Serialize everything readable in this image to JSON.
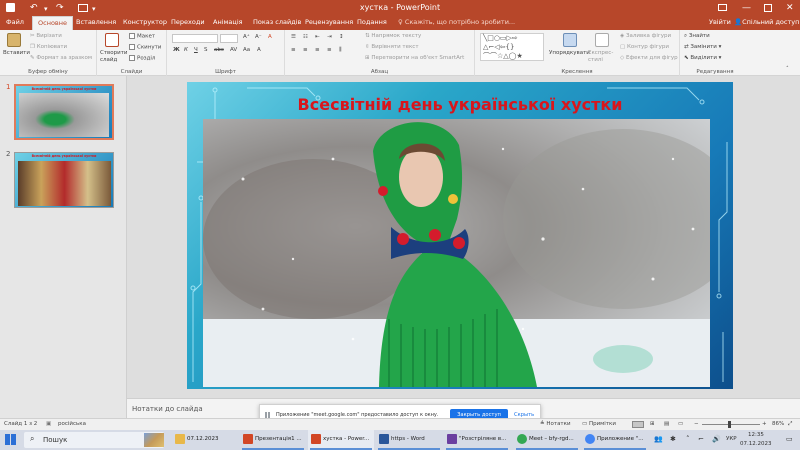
{
  "titlebar": {
    "title": "хустка - PowerPoint",
    "colors": {
      "bg": "#b7472a"
    }
  },
  "tabs": [
    {
      "label": "Файл",
      "active": false
    },
    {
      "label": "Основне",
      "active": true
    },
    {
      "label": "Вставлення",
      "active": false
    },
    {
      "label": "Конструктор",
      "active": false
    },
    {
      "label": "Переходи",
      "active": false
    },
    {
      "label": "Анімація",
      "active": false
    },
    {
      "label": "Показ слайдів",
      "active": false
    },
    {
      "label": "Рецензування",
      "active": false
    },
    {
      "label": "Подання",
      "active": false
    }
  ],
  "tellme": "Скажіть, що потрібно зробити...",
  "signin": "Увійти",
  "share": "Спільний доступ",
  "ribbon": {
    "clipboard": {
      "paste": "Вставити",
      "cut": "Вирізати",
      "copy": "Копіювати",
      "format": "Формат за зразком",
      "group": "Буфер обміну"
    },
    "slides": {
      "new_slide": "Створити слайд",
      "layout": "Макет",
      "reset": "Скинути",
      "section": "Розділ",
      "group": "Слайди"
    },
    "font": {
      "group": "Шрифт"
    },
    "paragraph": {
      "direction": "Напрямок тексту",
      "align": "Вирівняти текст",
      "smartart": "Перетворити на об'єкт SmartArt",
      "group": "Абзац"
    },
    "drawing": {
      "arrange": "Упорядкувати",
      "styles": "Експрес-стилі",
      "fill": "Заливка фігури",
      "outline": "Контур фігури",
      "effects": "Ефекти для фігур",
      "group": "Креслення"
    },
    "editing": {
      "find": "Знайти",
      "replace": "Замінити",
      "select": "Виділити",
      "group": "Редагування"
    }
  },
  "thumbs": [
    {
      "num": "1",
      "title": "Всесвітній день української хустки",
      "selected": true
    },
    {
      "num": "2",
      "title": "Всесвітній день української хустки",
      "selected": false
    }
  ],
  "slide": {
    "title": "Всесвітній день української хустки"
  },
  "notes": {
    "placeholder": "Нотатки до слайда"
  },
  "popup": {
    "text": "Приложение \"meet.google.com\" предоставило доступ к окну.",
    "button": "Закрыть доступ",
    "hide": "Скрыть"
  },
  "status": {
    "slide": "Слайд 1 з 2",
    "lang": "російська",
    "notes": "Нотатки",
    "comments": "Примітки",
    "zoom": "86%"
  },
  "taskbar": {
    "search": "Пошук",
    "items": [
      {
        "label": "07.12.2023",
        "color": "#e8b84a"
      },
      {
        "label": "Презентація1 ...",
        "color": "#d24726"
      },
      {
        "label": "хустка - Power...",
        "color": "#d24726"
      },
      {
        "label": "https - Word",
        "color": "#2b579a"
      },
      {
        "label": "\"Розстріляне в...",
        "color": "#6b3fa0"
      },
      {
        "label": "Meet – bfy-rgd...",
        "color": "#34a853"
      },
      {
        "label": "Приложение \"...",
        "color": "#4285f4"
      }
    ],
    "lang": "УКР",
    "time": "12:35",
    "date": "07.12.2023"
  }
}
